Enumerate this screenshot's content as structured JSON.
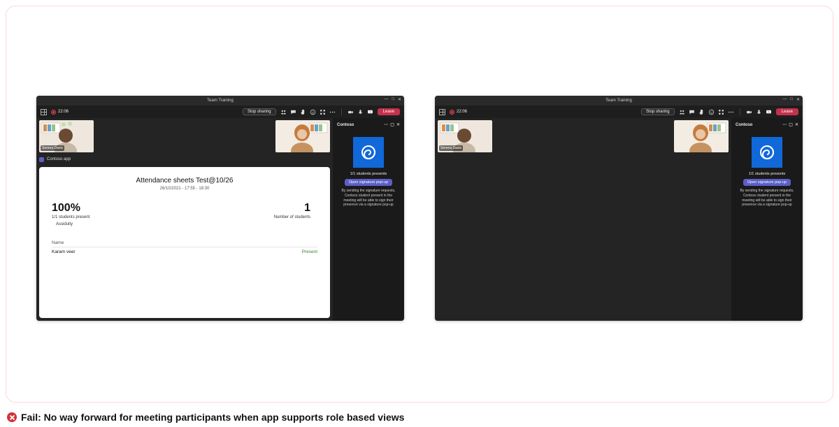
{
  "caption": {
    "status": "Fail",
    "text": "Fail: No way forward for meeting participants when app supports role based views"
  },
  "shared": {
    "window_title": "Team Training",
    "timer": "22:06",
    "stop_sharing": "Stop sharing",
    "leave": "Leave",
    "participant_left": "Serena Davis",
    "sidepanel": {
      "title": "Contoso",
      "students_line": "1/1 students presents",
      "button": "Open signature pop-up",
      "desc": "By sending the signature requests, Contoso student present in the meeting will be able to sign their presence via a signature pop-up"
    }
  },
  "left_card": {
    "tab_label": "Contoso app",
    "title": "Attendance sheets Test@10/26",
    "subtitle": "26/10/2021 - 17:55 - 18:30",
    "percent": "100%",
    "percent_label": "1/1 students present",
    "assiduity": "Assiduity",
    "count": "1",
    "count_label": "Number of students",
    "col_name": "Name",
    "row_name": "Karam veer",
    "row_status": "Present"
  }
}
